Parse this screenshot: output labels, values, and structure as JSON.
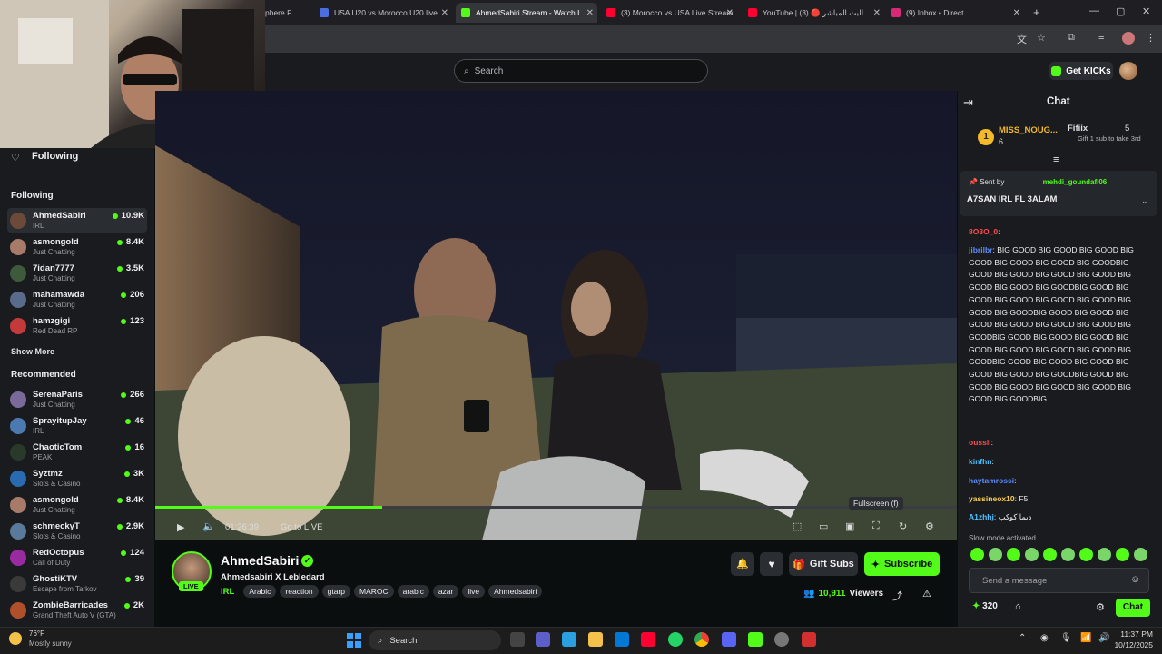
{
  "browser": {
    "tabs": [
      {
        "label": "phere F",
        "color": "#7b8794"
      },
      {
        "label": "USA U20 vs Morocco U20 live",
        "color": "#4a6ee0"
      },
      {
        "label": "AhmedSabiri Stream - Watch L",
        "color": "#53fc18",
        "active": true
      },
      {
        "label": "(3) Morocco vs USA Live Stream",
        "color": "#ff0033"
      },
      {
        "label": "YouTube | البث المباشر 🔴 (3)",
        "color": "#ff0033"
      },
      {
        "label": "(9) Inbox • Direct",
        "color": "#d62976"
      }
    ],
    "new_tab": "+"
  },
  "header": {
    "search_placeholder": "Search",
    "get_kicks": "Get KICKs"
  },
  "sidebar": {
    "following_title": "Following",
    "following_head": "Following",
    "following": [
      {
        "name": "AhmedSabiri",
        "category": "IRL",
        "viewers": "10.9K",
        "color": "#6b4a3a"
      },
      {
        "name": "asmongold",
        "category": "Just Chatting",
        "viewers": "8.4K",
        "color": "#a87a6a"
      },
      {
        "name": "7idan7777",
        "category": "Just Chatting",
        "viewers": "3.5K",
        "color": "#3d5a3a"
      },
      {
        "name": "mahamawda",
        "category": "Just Chatting",
        "viewers": "206",
        "color": "#5a6a8a"
      },
      {
        "name": "hamzgigi",
        "category": "Red Dead RP",
        "viewers": "123",
        "color": "#c43a3a"
      }
    ],
    "show_more": "Show More",
    "recommended_head": "Recommended",
    "recommended": [
      {
        "name": "SerenaParis",
        "category": "Just Chatting",
        "viewers": "266",
        "color": "#7a6a9a"
      },
      {
        "name": "SprayitupJay",
        "category": "IRL",
        "viewers": "46",
        "color": "#4a7ab0"
      },
      {
        "name": "ChaoticTom",
        "category": "PEAK",
        "viewers": "16",
        "color": "#2a3a2a"
      },
      {
        "name": "Syztmz",
        "category": "Slots & Casino",
        "viewers": "3K",
        "color": "#2a6ab0"
      },
      {
        "name": "asmongold",
        "category": "Just Chatting",
        "viewers": "8.4K",
        "color": "#a87a6a"
      },
      {
        "name": "schmeckyT",
        "category": "Slots & Casino",
        "viewers": "2.9K",
        "color": "#5a7a9a"
      },
      {
        "name": "RedOctopus",
        "category": "Call of Duty",
        "viewers": "124",
        "color": "#9a2aa0"
      },
      {
        "name": "GhostiKTV",
        "category": "Escape from Tarkov",
        "viewers": "39",
        "color": "#3a3a3a"
      },
      {
        "name": "ZombieBarricades",
        "category": "Grand Theft Auto V (GTA)",
        "viewers": "2K",
        "color": "#b0502a"
      }
    ]
  },
  "player": {
    "time": "01:26:39",
    "go_live": "Go to LIVE",
    "tooltip": "Fullscreen (f)"
  },
  "streamer": {
    "name": "AhmedSabiri",
    "title": "Ahmedsabiri X Lebledard",
    "live": "LIVE",
    "category": "IRL",
    "tags": [
      "Arabic",
      "reaction",
      "gtarp",
      "MAROC",
      "arabic",
      "azar",
      "live",
      "Ahmedsabiri"
    ],
    "gift_subs": "Gift Subs",
    "subscribe": "Subscribe",
    "viewers_count": "10,911",
    "viewers_label": "Viewers"
  },
  "chat": {
    "title": "Chat",
    "leader1": {
      "rank": "1",
      "name": "MISS_NOUG...",
      "count": "6"
    },
    "leader2": {
      "name": "Fifiix",
      "count": "5",
      "note": "Gift 1 sub to take 3rd"
    },
    "pinned": {
      "sent_by_label": "Sent by",
      "user": "mehdi_goundafi06",
      "message": "A7SAN IRL FL 3ALAM"
    },
    "messages": [
      {
        "user": "8O3O_0",
        "color": "#ff4d4d",
        "text": ""
      },
      {
        "user": "jibrilbr",
        "color": "#5b8cff",
        "text": "BIG GOOD BIG GOOD BIG GOOD BIG GOOD BIG GOOD BIG GOOD BIG GOODBIG GOOD BIG GOOD BIG GOOD BIG GOOD BIG GOOD BIG GOOD BIG GOODBIG GOOD BIG GOOD BIG GOOD BIG GOOD BIG GOOD BIG GOOD BIG GOODBIG GOOD BIG GOOD BIG GOOD BIG GOOD BIG GOOD BIG GOOD BIG GOODBIG GOOD BIG GOOD BIG GOOD BIG GOOD BIG GOOD BIG GOOD BIG GOOD BIG GOODBIG GOOD BIG GOOD BIG GOOD BIG GOOD BIG GOOD BIG GOODBIG GOOD BIG GOOD BIG GOOD BIG GOOD BIG GOOD BIG GOOD BIG GOODBIG"
      },
      {
        "user": "oussil",
        "color": "#ff4d4d",
        "text": ""
      },
      {
        "user": "kinfhn",
        "color": "#4dc3ff",
        "text": ""
      },
      {
        "user": "haytamrossi",
        "color": "#5b8cff",
        "text": ""
      },
      {
        "user": "yassineox10",
        "color": "#ffd24d",
        "text": "F5"
      },
      {
        "user": "A1zhhj",
        "color": "#4dc3ff",
        "text": "ديما كوكب"
      }
    ],
    "slow_mode": "Slow mode activated",
    "input_placeholder": "Send a message",
    "points": "320",
    "send": "Chat"
  },
  "taskbar": {
    "weather_temp": "76°F",
    "weather_desc": "Mostly sunny",
    "search": "Search",
    "time": "11:37 PM",
    "date": "10/12/2025"
  }
}
